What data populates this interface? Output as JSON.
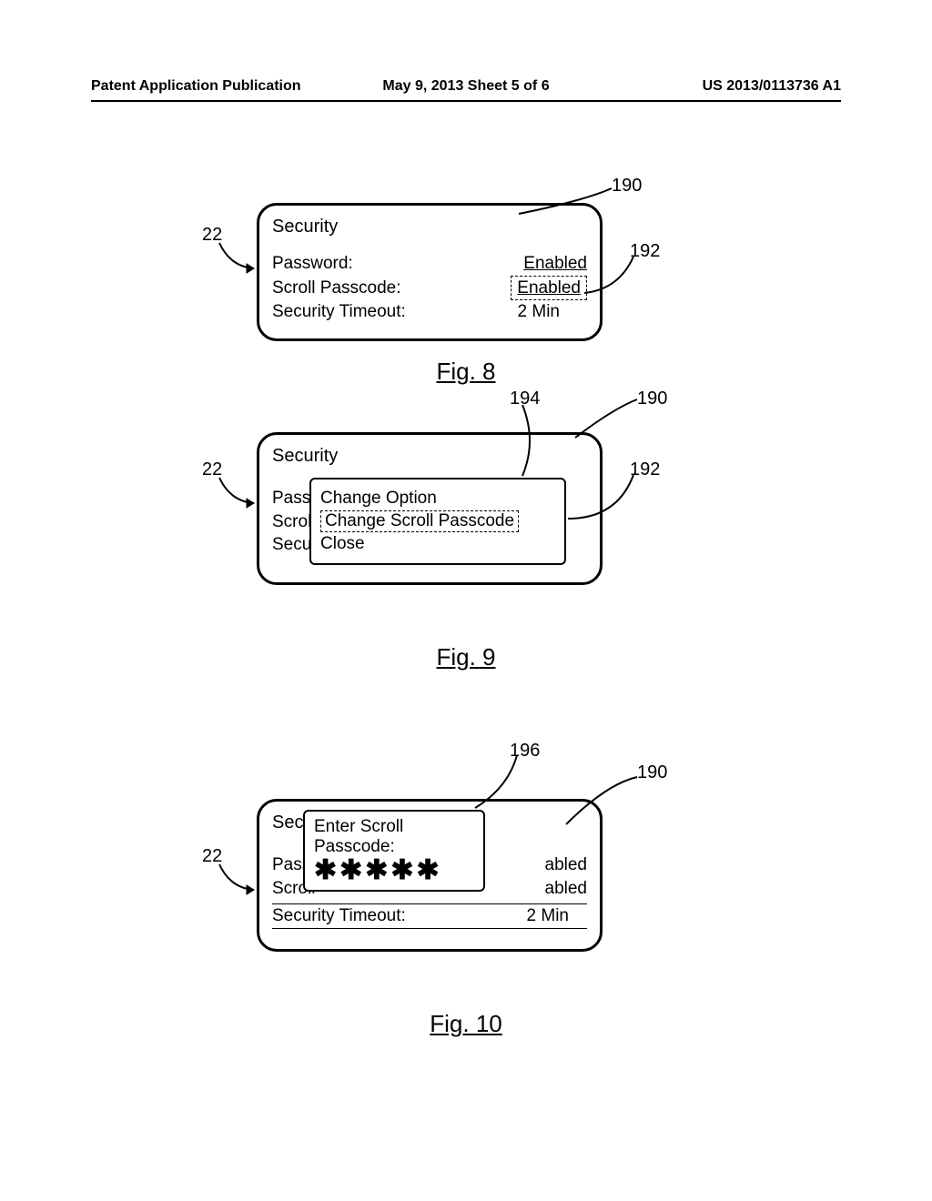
{
  "header": {
    "left": "Patent Application Publication",
    "center": "May 9, 2013  Sheet 5 of 6",
    "right": "US 2013/0113736 A1"
  },
  "fig8": {
    "caption": "Fig. 8",
    "screen": {
      "title": "Security",
      "rows": [
        {
          "label": "Password:",
          "value": "Enabled"
        },
        {
          "label": "Scroll Passcode:",
          "value": "Enabled"
        },
        {
          "label": "Security Timeout:",
          "value": "2 Min"
        }
      ]
    },
    "refs": {
      "r22": "22",
      "r190": "190",
      "r192": "192"
    }
  },
  "fig9": {
    "caption": "Fig. 9",
    "screen": {
      "title": "Security",
      "rows_bg": [
        {
          "label": "Passw"
        },
        {
          "label": "Scroll"
        },
        {
          "label": "Securi"
        }
      ]
    },
    "popup": {
      "opt1": "Change Option",
      "opt2": "Change Scroll Passcode",
      "opt3": "Close"
    },
    "refs": {
      "r22": "22",
      "r190": "190",
      "r192": "192",
      "r194": "194"
    }
  },
  "fig10": {
    "caption": "Fig. 10",
    "screen": {
      "title_bg": "Secur",
      "rows_bg": [
        {
          "label": "Passw",
          "value": "abled"
        },
        {
          "label": "Scroll",
          "value": "abled"
        },
        {
          "label": "Security Timeout:",
          "value": "2 Min"
        }
      ]
    },
    "popup": {
      "line1": "Enter Scroll",
      "line2": "Passcode:",
      "mask": "✱✱✱✱✱"
    },
    "refs": {
      "r22": "22",
      "r190": "190",
      "r196": "196"
    }
  }
}
